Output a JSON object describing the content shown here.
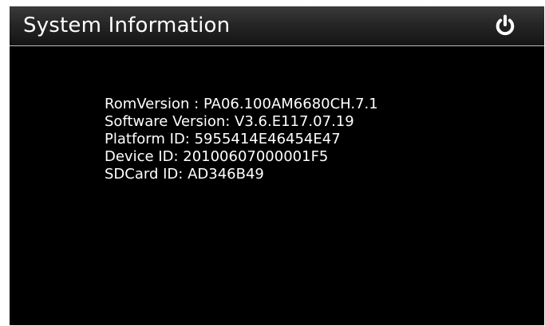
{
  "header": {
    "title": "System Information",
    "power_icon": "power-icon"
  },
  "info": {
    "rows": [
      "RomVersion : PA06.100AM6680CH.7.1",
      "Software Version: V3.6.E117.07.19",
      "Platform ID: 5955414E46454E47",
      "Device ID: 20100607000001F5",
      "SDCard ID: AD346B49"
    ]
  },
  "colors": {
    "background": "#000000",
    "text": "#ffffff",
    "header_divider": "#bdbdbd"
  }
}
